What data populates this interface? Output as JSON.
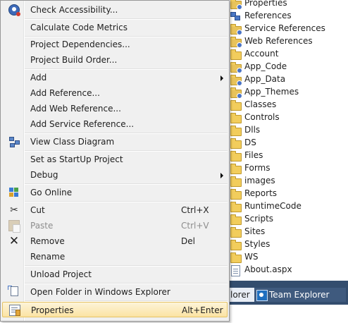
{
  "menu": {
    "items": [
      {
        "label": "Check Accessibility...",
        "icon": "accessibility-icon"
      },
      {
        "label": "Calculate Code Metrics"
      },
      {
        "label": "Project Dependencies..."
      },
      {
        "label": "Project Build Order..."
      },
      {
        "label": "Add"
      },
      {
        "label": "Add Reference..."
      },
      {
        "label": "Add Web Reference..."
      },
      {
        "label": "Add Service Reference..."
      },
      {
        "label": "View Class Diagram",
        "icon": "class-diagram-icon"
      },
      {
        "label": "Set as StartUp Project"
      },
      {
        "label": "Debug"
      },
      {
        "label": "Go Online",
        "icon": "go-online-icon"
      },
      {
        "label": "Cut",
        "shortcut": "Ctrl+X",
        "icon": "scissors-icon"
      },
      {
        "label": "Paste",
        "shortcut": "Ctrl+V",
        "icon": "paste-icon"
      },
      {
        "label": "Remove",
        "shortcut": "Del",
        "icon": "remove-icon"
      },
      {
        "label": "Rename"
      },
      {
        "label": "Unload Project"
      },
      {
        "label": "Open Folder in Windows Explorer",
        "icon": "open-folder-icon"
      },
      {
        "label": "Properties",
        "shortcut": "Alt+Enter",
        "icon": "properties-icon"
      }
    ]
  },
  "tree": {
    "items": [
      {
        "label": "Properties",
        "icon": "properties-folder-icon"
      },
      {
        "label": "References",
        "icon": "references-icon"
      },
      {
        "label": "Service References",
        "icon": "service-references-icon"
      },
      {
        "label": "Web References",
        "icon": "web-references-icon"
      },
      {
        "label": "Account",
        "icon": "folder-icon"
      },
      {
        "label": "App_Code",
        "icon": "folder-icon"
      },
      {
        "label": "App_Data",
        "icon": "folder-icon"
      },
      {
        "label": "App_Themes",
        "icon": "folder-icon"
      },
      {
        "label": "Classes",
        "icon": "folder-icon"
      },
      {
        "label": "Controls",
        "icon": "folder-icon"
      },
      {
        "label": "Dlls",
        "icon": "folder-icon"
      },
      {
        "label": "DS",
        "icon": "folder-icon"
      },
      {
        "label": "Files",
        "icon": "folder-icon"
      },
      {
        "label": "Forms",
        "icon": "folder-icon"
      },
      {
        "label": "images",
        "icon": "folder-icon"
      },
      {
        "label": "Reports",
        "icon": "folder-icon"
      },
      {
        "label": "RuntimeCode",
        "icon": "folder-icon"
      },
      {
        "label": "Scripts",
        "icon": "folder-icon"
      },
      {
        "label": "Sites",
        "icon": "folder-icon"
      },
      {
        "label": "Styles",
        "icon": "folder-icon"
      },
      {
        "label": "WS",
        "icon": "folder-icon"
      },
      {
        "label": "About.aspx",
        "icon": "aspx-page-icon"
      }
    ]
  },
  "tabs": {
    "explorer_partial": "lorer",
    "team_explorer": "Team Explorer"
  }
}
